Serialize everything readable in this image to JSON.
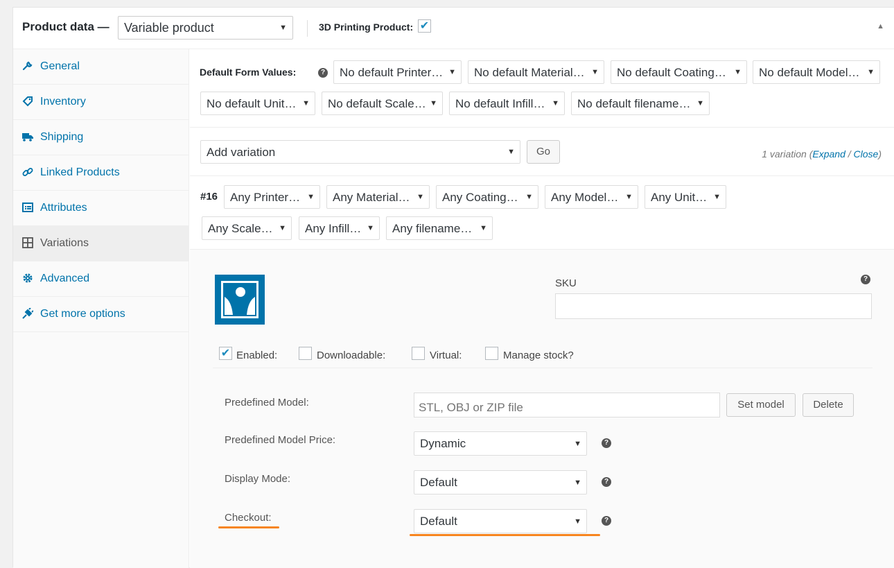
{
  "header": {
    "title": "Product data —",
    "product_type": "Variable product",
    "printing_label": "3D Printing Product:",
    "printing_checked": true,
    "toggle_icon": "triangle-up-icon"
  },
  "sidebar": {
    "items": [
      {
        "label": "General",
        "icon": "wrench-icon"
      },
      {
        "label": "Inventory",
        "icon": "tag-icon"
      },
      {
        "label": "Shipping",
        "icon": "truck-icon"
      },
      {
        "label": "Linked Products",
        "icon": "link-icon"
      },
      {
        "label": "Attributes",
        "icon": "list-icon"
      },
      {
        "label": "Variations",
        "icon": "grid-icon",
        "active": true
      },
      {
        "label": "Advanced",
        "icon": "gear-icon"
      },
      {
        "label": "Get more options",
        "icon": "plugin-icon"
      }
    ]
  },
  "defaults": {
    "label": "Default Form Values:",
    "selects": [
      "No default Printer…",
      "No default Material…",
      "No default Coating…",
      "No default Model…",
      "No default Unit…",
      "No default Scale…",
      "No default Infill…",
      "No default filename…"
    ]
  },
  "add_variation": {
    "select": "Add variation",
    "go": "Go",
    "count": "1 variation (",
    "expand": "Expand",
    "slash": " / ",
    "close": "Close",
    "close_paren": ")"
  },
  "variation": {
    "id": "#16",
    "selects": [
      "Any Printer…",
      "Any Material…",
      "Any Coating…",
      "Any Model…",
      "Any Unit…",
      "Any Scale…",
      "Any Infill…",
      "Any filename…"
    ],
    "sku_label": "SKU",
    "sku_value": "",
    "checkboxes": [
      {
        "label": "Enabled:",
        "checked": true
      },
      {
        "label": "Downloadable:",
        "checked": false
      },
      {
        "label": "Virtual:",
        "checked": false
      },
      {
        "label": "Manage stock?",
        "checked": false
      }
    ],
    "predefined_model_label": "Predefined Model:",
    "predefined_model_placeholder": "STL, OBJ or ZIP file",
    "set_model": "Set model",
    "delete": "Delete",
    "price_label": "Predefined Model Price:",
    "price_value": "Dynamic",
    "display_label": "Display Mode:",
    "display_value": "Default",
    "checkout_label": "Checkout:",
    "checkout_value": "Default"
  },
  "colors": {
    "accent": "#0073aa",
    "highlight": "#f7851f"
  }
}
